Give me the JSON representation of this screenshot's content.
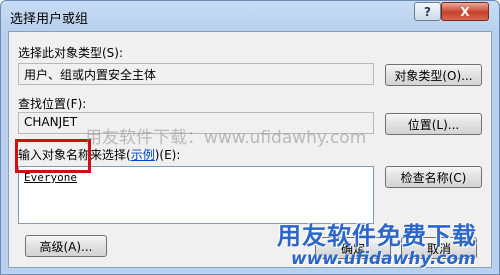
{
  "window": {
    "title": "选择用户或组",
    "help_symbol": "?",
    "close_symbol": "X"
  },
  "object_type": {
    "label": "选择此对象类型(S):",
    "value": "用户、组或内置安全主体",
    "button": "对象类型(O)..."
  },
  "location": {
    "label": "查找位置(F):",
    "value": "CHANJET",
    "button": "位置(L)..."
  },
  "names": {
    "label_prefix": "输入对象名称来选择(",
    "label_link": "示例",
    "label_suffix": ")(E):",
    "entered_name": "Everyone",
    "check_button": "检查名称(C)"
  },
  "footer": {
    "advanced_button": "高级(A)...",
    "ok_button": "确定",
    "cancel_button": "取消"
  },
  "watermarks": {
    "center_text": "用友软件下载：www.ufidawhy.com",
    "brand_text": "用友软件免费下载",
    "brand_url": "www.ufidawhy.com"
  },
  "colors": {
    "highlight_box": "#d01010",
    "link": "#0044cc",
    "watermark_brand": "#2c66c8"
  }
}
